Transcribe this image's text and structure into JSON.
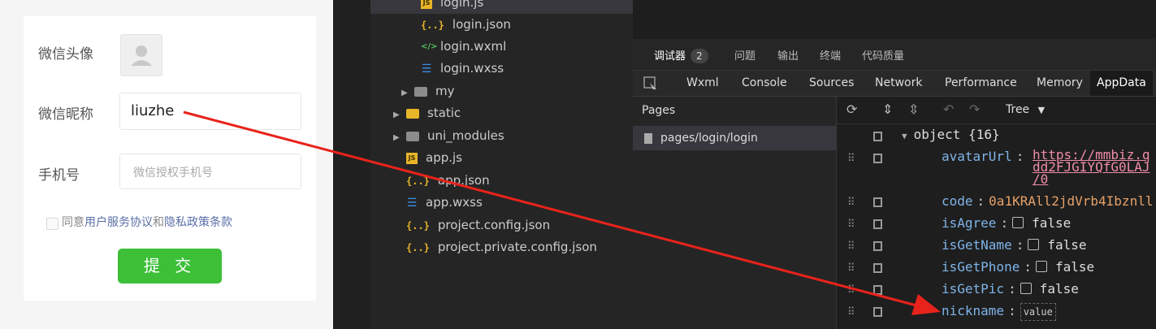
{
  "form": {
    "avatar_label": "微信头像",
    "nickname_label": "微信昵称",
    "nickname_value": "liuzhe",
    "phone_label": "手机号",
    "phone_placeholder": "微信授权手机号",
    "agree_prefix": "同意",
    "agree_link1": "用户服务协议",
    "agree_and": "和",
    "agree_link2": "隐私政策条款",
    "submit_label": "提 交"
  },
  "file_tree": [
    {
      "name": "login.js",
      "icon": "js"
    },
    {
      "name": "login.json",
      "icon": "json"
    },
    {
      "name": "login.wxml",
      "icon": "wxml"
    },
    {
      "name": "login.wxss",
      "icon": "wxss"
    },
    {
      "name": "my",
      "icon": "folder"
    },
    {
      "name": "static",
      "icon": "folder-yellow"
    },
    {
      "name": "uni_modules",
      "icon": "folder"
    },
    {
      "name": "app.js",
      "icon": "js"
    },
    {
      "name": "app.json",
      "icon": "json"
    },
    {
      "name": "app.wxss",
      "icon": "wxss"
    },
    {
      "name": "project.config.json",
      "icon": "json"
    },
    {
      "name": "project.private.config.json",
      "icon": "json"
    }
  ],
  "devtools": {
    "top_tabs": [
      "调试器",
      "问题",
      "输出",
      "终端",
      "代码质量"
    ],
    "debugger_badge": "2",
    "panel_tabs": [
      "Wxml",
      "Console",
      "Sources",
      "Network",
      "Performance",
      "Memory",
      "AppData"
    ],
    "active_panel": "AppData",
    "pages_header": "Pages",
    "page_item": "pages/login/login",
    "view_mode": "Tree",
    "root": "object {16}",
    "fields": [
      {
        "key": "avatarUrl",
        "value": "https://mmbiz.q",
        "value2": "dd2FJGIYQfG0LAJ",
        "value3": "/0"
      },
      {
        "key": "code",
        "value": "0a1KRAll2jdVrb4Ibznll"
      },
      {
        "key": "isAgree",
        "value": "false"
      },
      {
        "key": "isGetName",
        "value": "false"
      },
      {
        "key": "isGetPhone",
        "value": "false"
      },
      {
        "key": "isGetPic",
        "value": "false"
      },
      {
        "key": "nickname",
        "value": "value"
      }
    ]
  },
  "colors": {
    "submit": "#3dbf38",
    "arrow": "#e8231b",
    "key": "#7fb4e8"
  }
}
